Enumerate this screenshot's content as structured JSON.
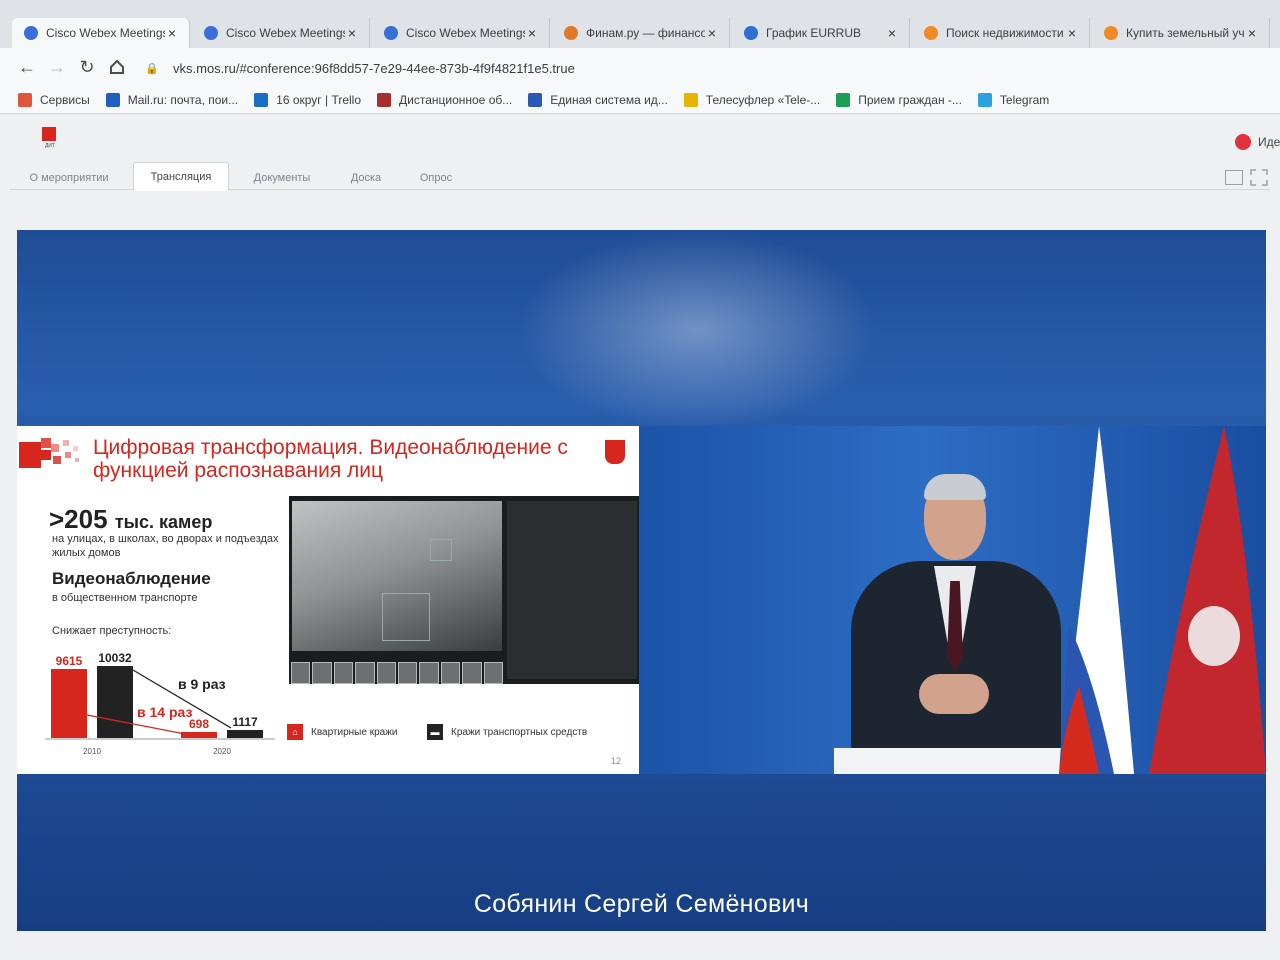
{
  "browser": {
    "tabs": [
      {
        "title": "Cisco Webex Meetings",
        "icon": "webex-icon",
        "color": "#3a6fd8"
      },
      {
        "title": "Cisco Webex Meetings",
        "icon": "webex-icon",
        "color": "#3a6fd8"
      },
      {
        "title": "Cisco Webex Meetings",
        "icon": "webex-icon",
        "color": "#3a6fd8"
      },
      {
        "title": "Финам.ру — финансовый",
        "icon": "finam-icon",
        "color": "#e07a2a"
      },
      {
        "title": "График EURRUB",
        "icon": "chart-icon",
        "color": "#2e6fd0"
      },
      {
        "title": "Поиск недвижимости",
        "icon": "orange-dot-icon",
        "color": "#f08a26"
      },
      {
        "title": "Купить земельный участок",
        "icon": "orange-dot-icon",
        "color": "#f08a26"
      }
    ],
    "url": "vks.mos.ru/#conference:96f8dd57-7e29-44ee-873b-4f9f4821f1e5.true",
    "bookmarks": [
      {
        "label": "Сервисы",
        "icon": "apps-grid-icon",
        "color": "#e0563b"
      },
      {
        "label": "Mail.ru: почта, пои...",
        "icon": "mailru-icon",
        "color": "#1e5fbf"
      },
      {
        "label": "16 округ | Trello",
        "icon": "trello-icon",
        "color": "#1b6ec2"
      },
      {
        "label": "Дистанционное об...",
        "icon": "bookmark-icon",
        "color": "#a6302b"
      },
      {
        "label": "Единая система ид...",
        "icon": "russia-flag-icon",
        "color": "#2c58b5"
      },
      {
        "label": "Телесуфлер «Tele-...",
        "icon": "colored-grid-icon",
        "color": "#e8b400"
      },
      {
        "label": "Прием граждан -...",
        "icon": "plus-sheet-icon",
        "color": "#1f9d55"
      },
      {
        "label": "Telegram",
        "icon": "telegram-icon",
        "color": "#2aa3e0"
      }
    ]
  },
  "site": {
    "logo_text": "ДИТ",
    "user_label": "Иде",
    "tabs": [
      "О мероприятии",
      "Трансляция",
      "Документы",
      "Доска",
      "Опрос"
    ],
    "active_tab": "Трансляция"
  },
  "slide": {
    "title": "Цифровая трансформация. Видеонаблюдение с функцией распознавания лиц",
    "cameras_big": ">205",
    "cameras_unit": "тыс. камер",
    "cameras_sub": "на улицах, в школах, во дворах и подъездах жилых домов",
    "transport_heading": "Видеонаблюдение",
    "transport_sub": "в общественном транспорте",
    "crime_label": "Снижает преступность:",
    "legend": [
      {
        "label": "Квартирные кражи",
        "color": "#d7261e",
        "icon": "house-icon"
      },
      {
        "label": "Кражи транспортных средств",
        "color": "#222222",
        "icon": "car-icon"
      }
    ],
    "page_number": "12"
  },
  "chart_data": {
    "type": "bar",
    "categories": [
      "2010",
      "2020"
    ],
    "series": [
      {
        "name": "Квартирные кражи",
        "values": [
          9615,
          698
        ],
        "color": "#d7261e"
      },
      {
        "name": "Кражи транспортных средств",
        "values": [
          10032,
          1117
        ],
        "color": "#222222"
      }
    ],
    "annotations": [
      "в 14 раз",
      "в 9 раз"
    ],
    "ylim": [
      0,
      10032
    ]
  },
  "caption": "Собянин Сергей Семёнович"
}
